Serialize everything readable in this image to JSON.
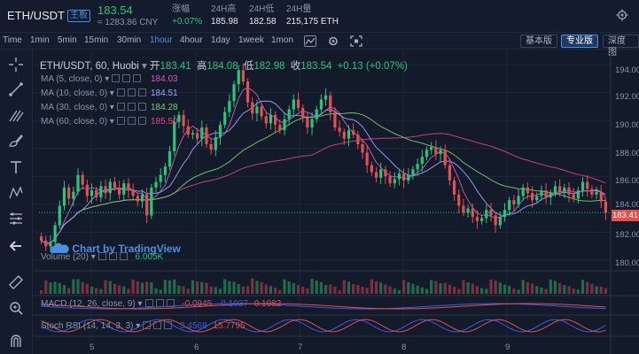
{
  "header": {
    "pair": "ETH/USDT",
    "badge": "主板",
    "price": "183.54",
    "cny": "≈ 1283.86 CNY",
    "stats": [
      {
        "label": "涨幅",
        "value": "+0.07%",
        "up": true
      },
      {
        "label": "24H高",
        "value": "185.98",
        "up": false
      },
      {
        "label": "24H低",
        "value": "182.58",
        "up": false
      },
      {
        "label": "24H量",
        "value": "215,175 ETH",
        "up": false
      }
    ]
  },
  "toolbar": {
    "timeframes": [
      "Time",
      "1min",
      "5min",
      "15min",
      "30min",
      "1hour",
      "4hour",
      "1day",
      "1week",
      "1mon"
    ],
    "active_timeframe": "1hour",
    "views": [
      "基本版",
      "专业版",
      "深度图"
    ],
    "active_view": "专业版"
  },
  "chart_header": {
    "symbol": "ETH/USDT, 60, Huobi",
    "open_label": "开",
    "open": "183.41",
    "high_label": "高",
    "high": "184.08",
    "low_label": "低",
    "low": "182.98",
    "close_label": "收",
    "close": "183.54",
    "change": "+0.13 (+0.07%)"
  },
  "ma": [
    {
      "label": "MA (5, close, 0)",
      "value": "184.03",
      "color": "#d15cc5"
    },
    {
      "label": "MA (10, close, 0)",
      "value": "184.51",
      "color": "#9aa6ff"
    },
    {
      "label": "MA (30, close, 0)",
      "value": "184.28",
      "color": "#77d26c"
    },
    {
      "label": "MA (60, close, 0)",
      "value": "185.50",
      "color": "#d9468a"
    }
  ],
  "watermark": "Chart by TradingView",
  "indicators": {
    "volume_label": "Volume (20)",
    "volume_value": "6.005K",
    "macd_label": "MACD (12, 26, close, 9)",
    "macd_v1": "-0.0945",
    "macd_v2": "-0.1037",
    "macd_v3": "0.1982",
    "stoch_label": "Stoch RSI (14, 14, 3, 3)",
    "stoch_v1": "3.4568",
    "stoch_v2": "15.7795"
  },
  "current_price_tag": "183.41",
  "chart_data": {
    "type": "candlestick",
    "y_ticks": [
      "194.00",
      "192.00",
      "190.00",
      "188.00",
      "186.00",
      "184.00",
      "182.00",
      "180.00"
    ],
    "y_range": [
      179.3,
      194.7
    ],
    "x_labels": [
      "5",
      "6",
      "7",
      "8",
      "9"
    ],
    "close": [
      181.4,
      181.0,
      181.3,
      182.5,
      183.9,
      185.2,
      184.4,
      184.9,
      186.1,
      185.4,
      184.6,
      185.0,
      184.5,
      185.3,
      184.8,
      185.6,
      185.2,
      184.7,
      185.5,
      185.0,
      184.6,
      184.2,
      184.7,
      183.2,
      185.2,
      185.6,
      186.1,
      186.7,
      187.8,
      189.9,
      190.4,
      189.6,
      189.0,
      189.1,
      188.7,
      189.5,
      188.3,
      187.9,
      188.8,
      189.7,
      190.6,
      191.4,
      192.6,
      193.6,
      192.8,
      191.3,
      190.5,
      191.0,
      190.3,
      189.8,
      190.4,
      189.7,
      189.3,
      190.1,
      190.8,
      191.5,
      190.9,
      190.2,
      189.5,
      190.1,
      190.8,
      191.5,
      191.8,
      190.6,
      189.5,
      189.2,
      188.7,
      189.3,
      189.0,
      188.3,
      187.7,
      186.8,
      186.3,
      185.9,
      186.5,
      186.0,
      185.5,
      185.8,
      186.2,
      185.7,
      186.1,
      186.5,
      186.9,
      187.4,
      187.9,
      188.1,
      187.6,
      187.9,
      186.8,
      185.7,
      184.7,
      183.9,
      183.4,
      183.7,
      183.1,
      182.8,
      183.0,
      183.6,
      183.2,
      182.5,
      183.1,
      183.6,
      184.3,
      184.0,
      184.6,
      185.2,
      184.8,
      184.3,
      184.6,
      185.0,
      184.5,
      184.8,
      185.3,
      184.9,
      185.2,
      184.7,
      184.4,
      185.0,
      185.6,
      185.1,
      184.7,
      184.9,
      184.2,
      183.4
    ]
  }
}
